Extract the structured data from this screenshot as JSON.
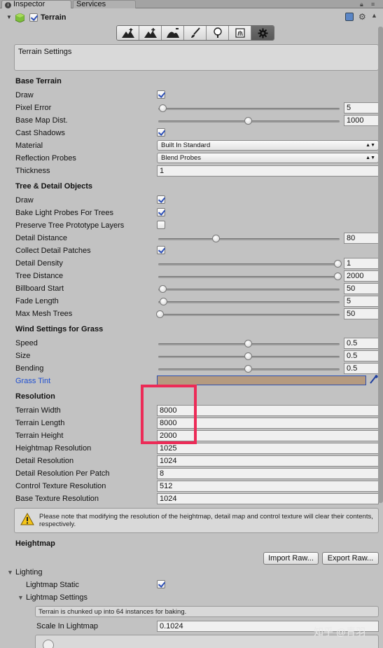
{
  "tabs": {
    "inspector": "Inspector",
    "services": "Services"
  },
  "component": {
    "title": "Terrain"
  },
  "toolbar": {
    "tools": [
      {
        "icon": "raise-terrain-icon"
      },
      {
        "icon": "paint-height-icon"
      },
      {
        "icon": "smooth-height-icon"
      },
      {
        "icon": "paint-texture-icon"
      },
      {
        "icon": "place-trees-icon"
      },
      {
        "icon": "paint-details-icon"
      },
      {
        "icon": "terrain-settings-gear-icon"
      }
    ],
    "active_index": 6
  },
  "help_title": "Terrain Settings",
  "base_terrain": {
    "header": "Base Terrain",
    "draw": {
      "label": "Draw",
      "checked": true
    },
    "pixel_error": {
      "label": "Pixel Error",
      "value": "5",
      "fraction": 0.02
    },
    "base_map_dist": {
      "label": "Base Map Dist.",
      "value": "1000",
      "fraction": 0.5
    },
    "cast_shadows": {
      "label": "Cast Shadows",
      "checked": true
    },
    "material": {
      "label": "Material",
      "value": "Built In Standard"
    },
    "reflection_probes": {
      "label": "Reflection Probes",
      "value": "Blend Probes"
    },
    "thickness": {
      "label": "Thickness",
      "value": "1"
    }
  },
  "tree_detail": {
    "header": "Tree & Detail Objects",
    "draw": {
      "label": "Draw",
      "checked": true
    },
    "bake_light_probes": {
      "label": "Bake Light Probes For Trees",
      "checked": true
    },
    "preserve_tree_layers": {
      "label": "Preserve Tree Prototype Layers",
      "checked": false
    },
    "detail_distance": {
      "label": "Detail Distance",
      "value": "80",
      "fraction": 0.32
    },
    "collect_detail_patches": {
      "label": "Collect Detail Patches",
      "checked": true
    },
    "detail_density": {
      "label": "Detail Density",
      "value": "1",
      "fraction": 1.0
    },
    "tree_distance": {
      "label": "Tree Distance",
      "value": "2000",
      "fraction": 1.0
    },
    "billboard_start": {
      "label": "Billboard Start",
      "value": "50",
      "fraction": 0.02
    },
    "fade_length": {
      "label": "Fade Length",
      "value": "5",
      "fraction": 0.025
    },
    "max_mesh_trees": {
      "label": "Max Mesh Trees",
      "value": "50",
      "fraction": 0.0
    }
  },
  "wind": {
    "header": "Wind Settings for Grass",
    "speed": {
      "label": "Speed",
      "value": "0.5",
      "fraction": 0.5
    },
    "size": {
      "label": "Size",
      "value": "0.5",
      "fraction": 0.5
    },
    "bending": {
      "label": "Bending",
      "value": "0.5",
      "fraction": 0.5
    },
    "grass_tint": {
      "label": "Grass Tint",
      "color": "#b59a7f"
    }
  },
  "resolution": {
    "header": "Resolution",
    "terrain_width": {
      "label": "Terrain Width",
      "value": "8000"
    },
    "terrain_length": {
      "label": "Terrain Length",
      "value": "8000"
    },
    "terrain_height": {
      "label": "Terrain Height",
      "value": "2000"
    },
    "heightmap_resolution": {
      "label": "Heightmap Resolution",
      "value": "1025"
    },
    "detail_resolution": {
      "label": "Detail Resolution",
      "value": "1024"
    },
    "detail_resolution_per_patch": {
      "label": "Detail Resolution Per Patch",
      "value": "8"
    },
    "control_texture_resolution": {
      "label": "Control Texture Resolution",
      "value": "512"
    },
    "base_texture_resolution": {
      "label": "Base Texture Resolution",
      "value": "1024"
    },
    "warning": "Please note that modifying the resolution of the heightmap, detail map and control texture will clear their contents, respectively."
  },
  "heightmap": {
    "header": "Heightmap",
    "import_label": "Import Raw...",
    "export_label": "Export Raw..."
  },
  "lighting": {
    "header": "Lighting",
    "lightmap_static": {
      "label": "Lightmap Static",
      "checked": true
    },
    "lightmap_settings": "Lightmap Settings",
    "chunk_note": "Terrain is chunked up into 64 instances for baking.",
    "scale_in_lightmap": {
      "label": "Scale In Lightmap",
      "value": "0.1024"
    }
  },
  "watermark": "知乎 @青羽",
  "colors": {
    "highlight": "#ec2b57",
    "link_label": "#1f4fd1",
    "panel": "#c2c2c2"
  }
}
